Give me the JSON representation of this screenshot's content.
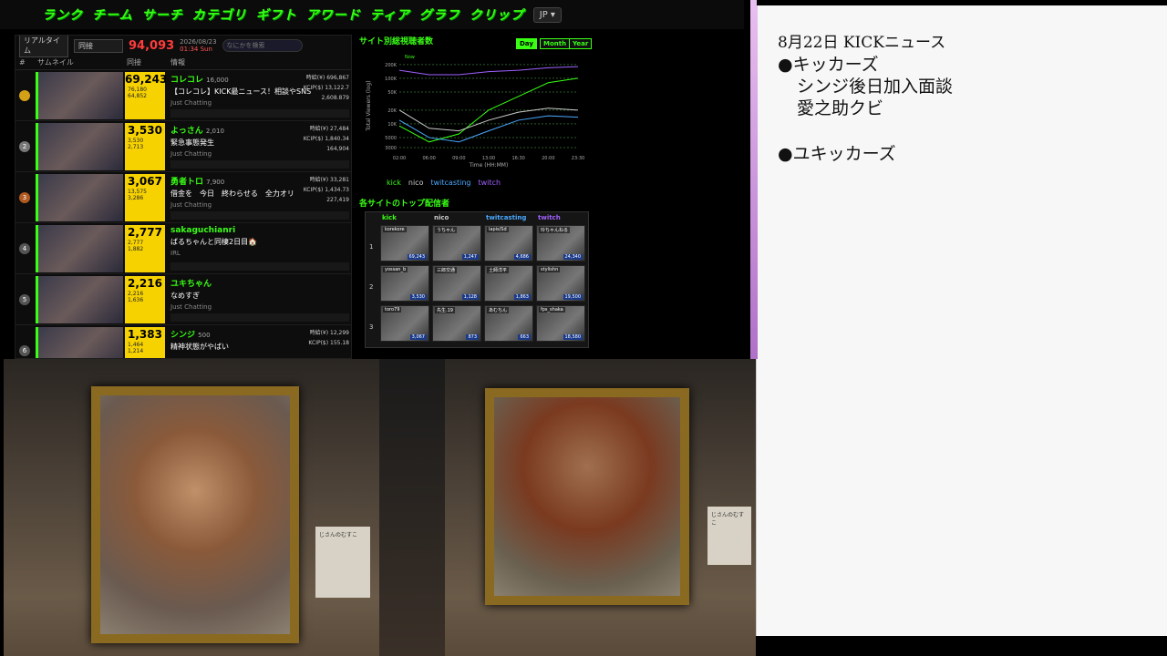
{
  "nav": {
    "items": [
      "ランク",
      "チーム",
      "サーチ",
      "カテゴリ",
      "ギフト",
      "アワード",
      "ティア",
      "グラフ",
      "クリップ"
    ],
    "lang": "JP ▾"
  },
  "controls": {
    "mode": "リアルタイム",
    "filter": "同接",
    "total": "94,093",
    "date": "2026/08/23",
    "time": "01:34 Sun",
    "search_placeholder": "なにかを検索"
  },
  "table": {
    "headers": [
      "#",
      "サムネイル",
      "同接",
      "情報"
    ]
  },
  "streamers": [
    {
      "rank": "",
      "viewers": "69,243",
      "max": "76,180",
      "avg": "64,852",
      "name": "コレコレ",
      "followers": "16,000",
      "title": "【コレコレ】KICK最ニュース！相談やSNS",
      "cat": "Just Chatting",
      "s1": "時給(¥) 696,867",
      "s2": "KCIP($) 13,122.7",
      "s3": "2,608.879"
    },
    {
      "rank": "2",
      "viewers": "3,530",
      "max": "3,530",
      "avg": "2,713",
      "name": "よっさん",
      "followers": "2,010",
      "title": "緊急事態発生",
      "cat": "Just Chatting",
      "s1": "時給(¥) 27,484",
      "s2": "KCIP($) 1,840.34",
      "s3": "164,904"
    },
    {
      "rank": "3",
      "viewers": "3,067",
      "max": "13,575",
      "avg": "3,286",
      "name": "勇者トロ",
      "followers": "7,900",
      "title": "借金を　今日　終わらせる　全力オリ",
      "cat": "Just Chatting",
      "s1": "時給(¥) 33,281",
      "s2": "KCIP($) 1,434.73",
      "s3": "227,419"
    },
    {
      "rank": "4",
      "viewers": "2,777",
      "max": "2,777",
      "avg": "1,882",
      "name": "sakaguchianri",
      "followers": "",
      "title": "ばるちゃんと同棲2日目🏠",
      "cat": "IRL",
      "s1": "",
      "s2": "",
      "s3": ""
    },
    {
      "rank": "5",
      "viewers": "2,216",
      "max": "2,216",
      "avg": "1,636",
      "name": "ユキちゃん",
      "followers": "",
      "title": "なめすぎ",
      "cat": "Just Chatting",
      "s1": "",
      "s2": "",
      "s3": ""
    },
    {
      "rank": "6",
      "viewers": "1,383",
      "max": "1,464",
      "avg": "1,214",
      "name": "シンジ",
      "followers": "500",
      "title": "精神状態がやばい",
      "cat": "",
      "s1": "時給(¥) 12,299",
      "s2": "KCIP($) 155.18",
      "s3": ""
    }
  ],
  "chart": {
    "title": "サイト別総視聴者数",
    "toggles": [
      "Day",
      "Month",
      "Year"
    ],
    "ylabel": "Total Viewers (log)",
    "xlabel": "Time (HH:MM)",
    "legend": [
      "kick",
      "nico",
      "twitcasting",
      "twitch"
    ],
    "now": "Now"
  },
  "chart_data": {
    "type": "line",
    "x": [
      "02:00",
      "06:00",
      "09:00",
      "13:00",
      "16:30",
      "20:00",
      "23:30"
    ],
    "yticks": [
      "200K",
      "100K",
      "50K",
      "20K",
      "10K",
      "5000",
      "3000"
    ],
    "series": [
      {
        "name": "kick",
        "values": [
          9000,
          4000,
          6000,
          20000,
          40000,
          80000,
          100000
        ]
      },
      {
        "name": "twitch",
        "values": [
          150000,
          120000,
          120000,
          140000,
          150000,
          170000,
          180000
        ]
      },
      {
        "name": "twitcasting",
        "values": [
          12000,
          5000,
          4000,
          7000,
          12000,
          15000,
          14000
        ]
      },
      {
        "name": "nico",
        "values": [
          20000,
          8000,
          7000,
          12000,
          18000,
          22000,
          20000
        ]
      }
    ]
  },
  "tops": {
    "title": "各サイトのトップ配信者",
    "cols": [
      "kick",
      "nico",
      "twitcasting",
      "twitch"
    ],
    "cells": [
      [
        "korekore",
        "うちゃん",
        "lapis/Sd",
        "玲ちゃんねる"
      ],
      [
        "yossan_b",
        "三郎交通",
        "土師洋平",
        "stylishn"
      ],
      [
        "toro79",
        "先生.19",
        "あむちん",
        "fps_shaka"
      ]
    ],
    "vals": [
      [
        "69,243",
        "1,247",
        "4,686",
        "24,340"
      ],
      [
        "3,530",
        "1,128",
        "1,863",
        "19,500"
      ],
      [
        "3,067",
        "873",
        "663",
        "18,580"
      ]
    ]
  },
  "museum": {
    "plaque1": "じさんのむすこ",
    "plaque2": "じさんのむすこ"
  },
  "notes": {
    "l1": "8月22日 KICKニュース",
    "l2": "●キッカーズ",
    "l3": "シンジ後日加入面談",
    "l4": "愛之助クビ",
    "l5": "●ユキッカーズ"
  }
}
